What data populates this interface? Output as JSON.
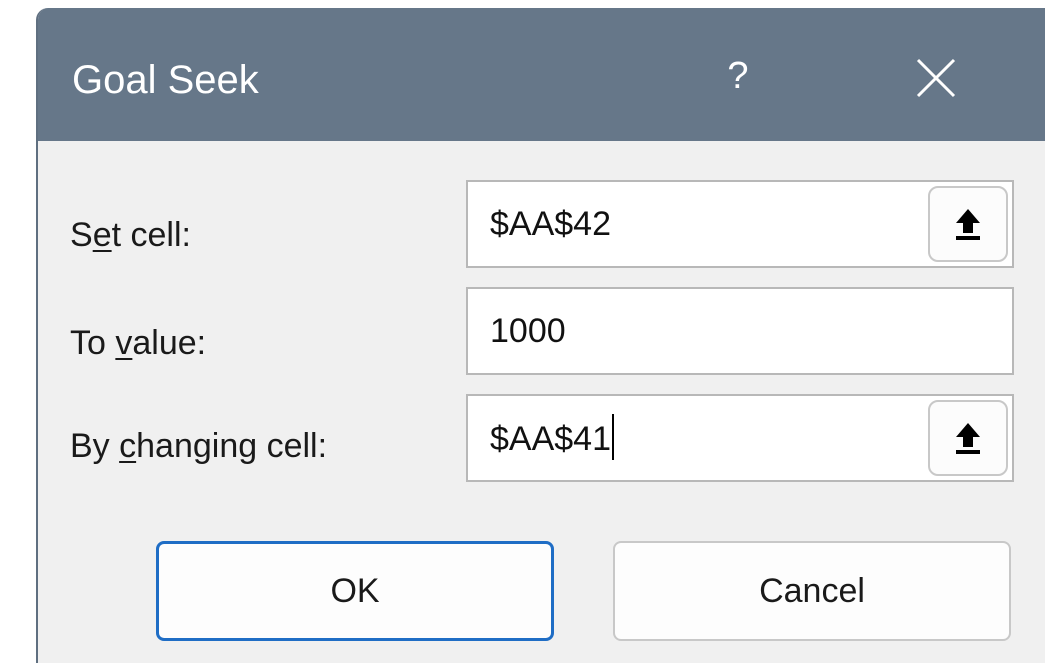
{
  "dialog": {
    "title": "Goal Seek",
    "help_label": "?",
    "close_icon": "close-icon"
  },
  "fields": {
    "set_cell": {
      "label_pre": "S",
      "label_accel": "e",
      "label_post": "t cell:",
      "value": "$AA$42",
      "collapse_icon": "collapse-dialog-icon"
    },
    "to_value": {
      "label_pre": "To ",
      "label_accel": "v",
      "label_post": "alue:",
      "value": "1000"
    },
    "by_changing_cell": {
      "label_pre": "By ",
      "label_accel": "c",
      "label_post": "hanging cell:",
      "value": "$AA$41",
      "collapse_icon": "collapse-dialog-icon"
    }
  },
  "buttons": {
    "ok_label": "OK",
    "cancel_label": "Cancel"
  },
  "colors": {
    "titlebar": "#667789",
    "dialog_bg": "#f0f0f0",
    "default_button_border": "#1f6dc5"
  }
}
